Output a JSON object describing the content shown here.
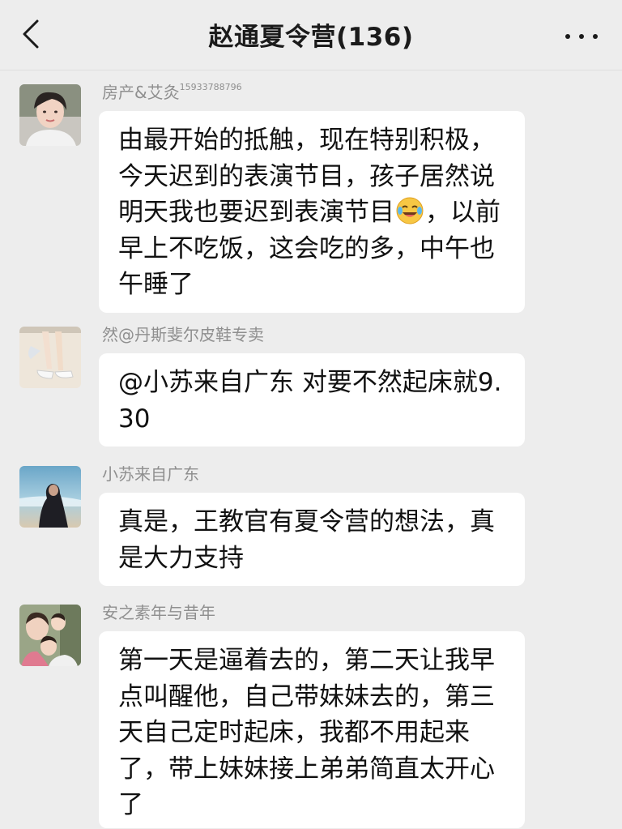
{
  "header": {
    "title": "赵通夏令营(136)"
  },
  "messages": [
    {
      "sender": "房产&艾灸",
      "sender_suffix": "15933788796",
      "text_before_emoji": "由最开始的抵触，现在特别积极，今天迟到的表演节目，孩子居然说明天我也要迟到表演节目",
      "emoji": "laugh-cry-emoji",
      "text_after_emoji": "，以前早上不吃饭，这会吃的多，中午也午睡了"
    },
    {
      "sender": "然@丹斯斐尔皮鞋专卖",
      "text": "@小苏来自广东  对要不然起床就9.30"
    },
    {
      "sender": "小苏来自广东",
      "text": "真是，王教官有夏令营的想法，真是大力支持"
    },
    {
      "sender": "安之素年与昔年",
      "text": "第一天是逼着去的，第二天让我早点叫醒他，自己带妹妹去的，第三天自己定时起床，我都不用起来了，带上妹妹接上弟弟简直太开心了"
    }
  ],
  "colors": {
    "background": "#ededed",
    "bubble": "#ffffff",
    "sender_name": "#8f8f8f",
    "title": "#1b1b1b"
  }
}
